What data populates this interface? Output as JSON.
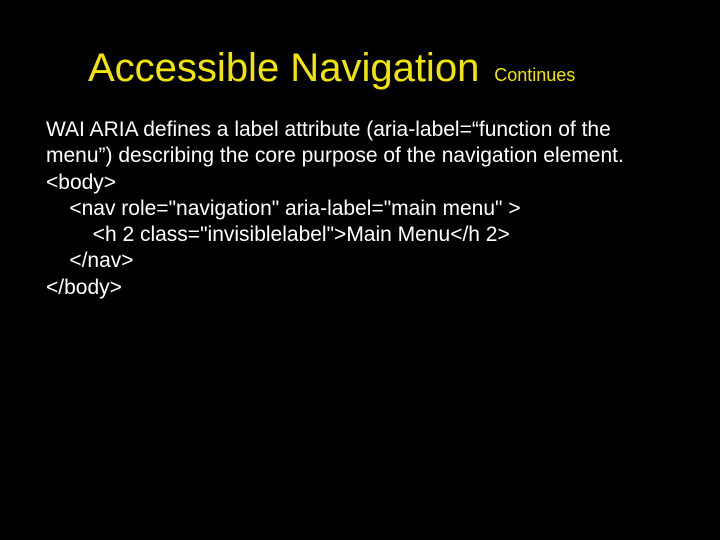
{
  "title": {
    "main": "Accessible Navigation",
    "sub": "Continues"
  },
  "paragraph": "WAI ARIA defines a label attribute (aria-label=“function of the menu”) describing the core purpose of the navigation element.",
  "code": "<body>\n    <nav role=\"navigation\" aria-label=\"main menu\" >\n        <h 2 class=\"invisiblelabel\">Main Menu</h 2>\n    </nav>\n</body>"
}
